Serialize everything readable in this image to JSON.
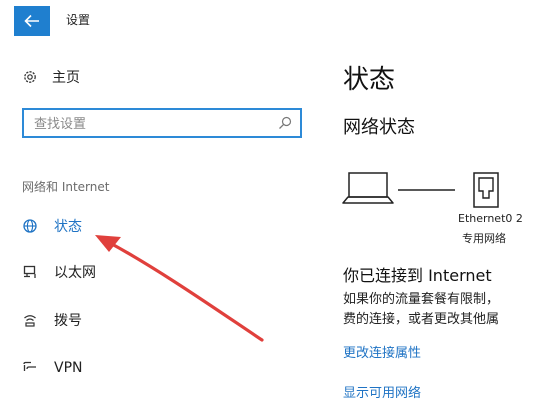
{
  "window": {
    "title": "设置",
    "back_icon": "arrow-left-icon",
    "accent_color": "#1f7fcf"
  },
  "sidebar": {
    "home": {
      "label": "主页",
      "icon": "gear-icon"
    },
    "search": {
      "placeholder": "查找设置",
      "icon": "search-icon"
    },
    "section_header": "网络和 Internet",
    "items": [
      {
        "label": "状态",
        "icon": "globe-icon",
        "active": true
      },
      {
        "label": "以太网",
        "icon": "monitor-icon",
        "active": false
      },
      {
        "label": "拨号",
        "icon": "dialup-icon",
        "active": false
      },
      {
        "label": "VPN",
        "icon": "vpn-icon",
        "active": false
      }
    ]
  },
  "main": {
    "title": "状态",
    "network_status_title": "网络状态",
    "adapter_name": "Ethernet0 2",
    "network_type": "专用网络",
    "connected_heading": "你已连接到 Internet",
    "description_lines": [
      "如果你的流量套餐有限制，",
      "费的连接，或者更改其他属"
    ],
    "links": {
      "change_properties": "更改连接属性",
      "show_networks": "显示可用网络"
    },
    "link_color": "#1f73c4"
  },
  "annotation": {
    "arrow_color": "#e0403c"
  }
}
